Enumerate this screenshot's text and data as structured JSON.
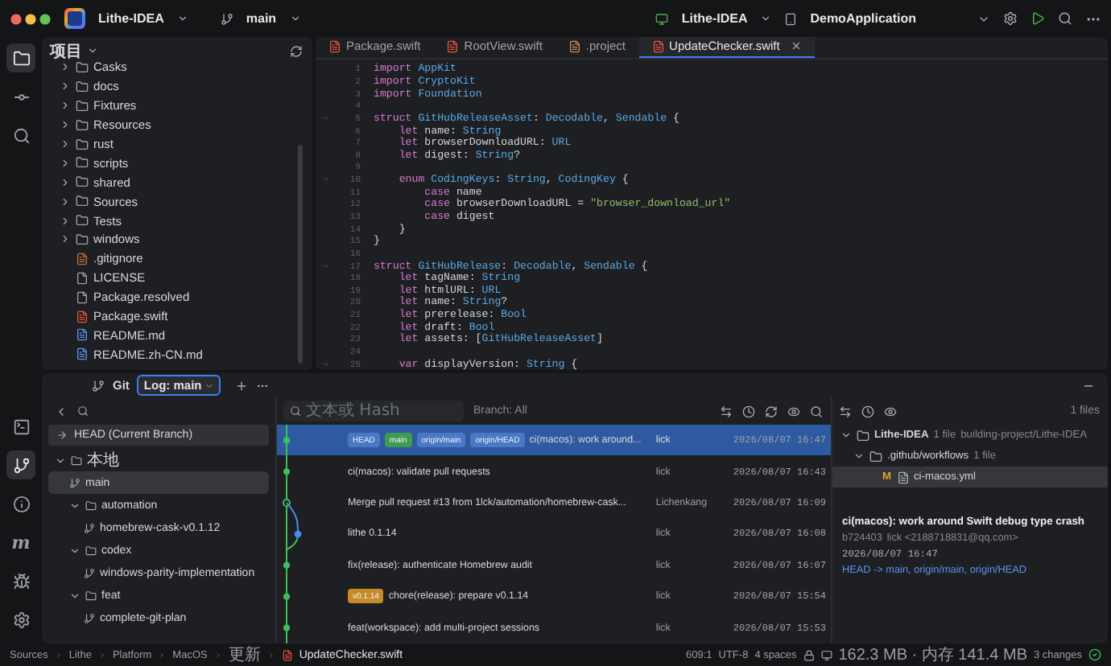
{
  "title_bar": {
    "project": "Lithe-IDEA",
    "branch": "main",
    "run_config": "Lithe-IDEA",
    "device": "DemoApplication"
  },
  "activity_bar": {
    "top": [
      {
        "kind": "project",
        "selected": true
      },
      {
        "kind": "commit",
        "selected": false
      },
      {
        "kind": "search",
        "selected": false
      }
    ],
    "bottom": [
      {
        "kind": "terminal",
        "selected": false
      },
      {
        "kind": "git",
        "selected": true
      },
      {
        "kind": "problems",
        "selected": false
      },
      {
        "kind": "text",
        "label": "m",
        "selected": false
      },
      {
        "kind": "debug",
        "selected": false
      },
      {
        "kind": "settings",
        "selected": false
      }
    ]
  },
  "project_panel": {
    "title": "项目",
    "items": [
      {
        "kind": "folder",
        "name": "Casks",
        "expanded": false
      },
      {
        "kind": "folder",
        "name": "docs",
        "expanded": false
      },
      {
        "kind": "folder",
        "name": "Fixtures",
        "expanded": false
      },
      {
        "kind": "folder",
        "name": "Resources",
        "expanded": false
      },
      {
        "kind": "folder",
        "name": "rust",
        "expanded": false
      },
      {
        "kind": "folder",
        "name": "scripts",
        "expanded": false
      },
      {
        "kind": "folder",
        "name": "shared",
        "expanded": false
      },
      {
        "kind": "folder",
        "name": "Sources",
        "expanded": false
      },
      {
        "kind": "folder",
        "name": "Tests",
        "expanded": false
      },
      {
        "kind": "folder",
        "name": "windows",
        "expanded": false
      },
      {
        "kind": "ignore",
        "name": ".gitignore"
      },
      {
        "kind": "doc",
        "name": "LICENSE"
      },
      {
        "kind": "doc",
        "name": "Package.resolved"
      },
      {
        "kind": "swift",
        "name": "Package.swift"
      },
      {
        "kind": "markdown",
        "name": "README.md"
      },
      {
        "kind": "markdown",
        "name": "README.zh-CN.md"
      }
    ]
  },
  "editor": {
    "tabs": [
      {
        "kind": "swift",
        "label": "Package.swift",
        "selected": false
      },
      {
        "kind": "swift",
        "label": "RootView.swift",
        "selected": false
      },
      {
        "kind": "xml",
        "label": ".project",
        "selected": false
      },
      {
        "kind": "swift",
        "label": "UpdateChecker.swift",
        "selected": true
      }
    ],
    "lines": [
      {
        "number": "1",
        "tokens": [
          {
            "kind": "kw",
            "text": "import "
          },
          {
            "kind": "type",
            "text": "AppKit"
          }
        ]
      },
      {
        "number": "2",
        "tokens": [
          {
            "kind": "kw",
            "text": "import "
          },
          {
            "kind": "type",
            "text": "CryptoKit"
          }
        ]
      },
      {
        "number": "3",
        "tokens": [
          {
            "kind": "kw",
            "text": "import "
          },
          {
            "kind": "type",
            "text": "Foundation"
          }
        ]
      },
      {
        "number": "4"
      },
      {
        "number": "5",
        "fold": true,
        "tokens": [
          {
            "kind": "kw",
            "text": "struct "
          },
          {
            "kind": "type",
            "text": "GitHubReleaseAsset"
          },
          {
            "kind": "plain",
            "text": ": "
          },
          {
            "kind": "type",
            "text": "Decodable"
          },
          {
            "kind": "plain",
            "text": ", "
          },
          {
            "kind": "type",
            "text": "Sendable"
          },
          {
            "kind": "plain",
            "text": " {"
          }
        ]
      },
      {
        "number": "6",
        "tokens": [
          {
            "kind": "kw",
            "text": "    let "
          },
          {
            "kind": "plain",
            "text": "name: "
          },
          {
            "kind": "type",
            "text": "String"
          }
        ]
      },
      {
        "number": "7",
        "tokens": [
          {
            "kind": "kw",
            "text": "    let "
          },
          {
            "kind": "plain",
            "text": "browserDownloadURL: "
          },
          {
            "kind": "type",
            "text": "URL"
          }
        ]
      },
      {
        "number": "8",
        "tokens": [
          {
            "kind": "kw",
            "text": "    let "
          },
          {
            "kind": "plain",
            "text": "digest: "
          },
          {
            "kind": "type",
            "text": "String"
          },
          {
            "kind": "plain",
            "text": "?"
          }
        ]
      },
      {
        "number": "9"
      },
      {
        "number": "10",
        "fold": true,
        "tokens": [
          {
            "kind": "kw",
            "text": "    enum "
          },
          {
            "kind": "type",
            "text": "CodingKeys"
          },
          {
            "kind": "plain",
            "text": ": "
          },
          {
            "kind": "type",
            "text": "String"
          },
          {
            "kind": "plain",
            "text": ", "
          },
          {
            "kind": "type",
            "text": "CodingKey"
          },
          {
            "kind": "plain",
            "text": " {"
          }
        ]
      },
      {
        "number": "11",
        "tokens": [
          {
            "kind": "kw",
            "text": "        case "
          },
          {
            "kind": "plain",
            "text": "name"
          }
        ]
      },
      {
        "number": "12",
        "tokens": [
          {
            "kind": "kw",
            "text": "        case "
          },
          {
            "kind": "plain",
            "text": "browserDownloadURL = "
          },
          {
            "kind": "str",
            "text": "\"browser_download_url\""
          }
        ]
      },
      {
        "number": "13",
        "tokens": [
          {
            "kind": "kw",
            "text": "        case "
          },
          {
            "kind": "plain",
            "text": "digest"
          }
        ]
      },
      {
        "number": "14",
        "tokens": [
          {
            "kind": "plain",
            "text": "    }"
          }
        ]
      },
      {
        "number": "15",
        "tokens": [
          {
            "kind": "plain",
            "text": "}"
          }
        ]
      },
      {
        "number": "16"
      },
      {
        "number": "17",
        "fold": true,
        "tokens": [
          {
            "kind": "kw",
            "text": "struct "
          },
          {
            "kind": "type",
            "text": "GitHubRelease"
          },
          {
            "kind": "plain",
            "text": ": "
          },
          {
            "kind": "type",
            "text": "Decodable"
          },
          {
            "kind": "plain",
            "text": ", "
          },
          {
            "kind": "type",
            "text": "Sendable"
          },
          {
            "kind": "plain",
            "text": " {"
          }
        ]
      },
      {
        "number": "18",
        "tokens": [
          {
            "kind": "kw",
            "text": "    let "
          },
          {
            "kind": "plain",
            "text": "tagName: "
          },
          {
            "kind": "type",
            "text": "String"
          }
        ]
      },
      {
        "number": "19",
        "tokens": [
          {
            "kind": "kw",
            "text": "    let "
          },
          {
            "kind": "plain",
            "text": "htmlURL: "
          },
          {
            "kind": "type",
            "text": "URL"
          }
        ]
      },
      {
        "number": "20",
        "tokens": [
          {
            "kind": "kw",
            "text": "    let "
          },
          {
            "kind": "plain",
            "text": "name: "
          },
          {
            "kind": "type",
            "text": "String"
          },
          {
            "kind": "plain",
            "text": "?"
          }
        ]
      },
      {
        "number": "21",
        "tokens": [
          {
            "kind": "kw",
            "text": "    let "
          },
          {
            "kind": "plain",
            "text": "prerelease: "
          },
          {
            "kind": "type",
            "text": "Bool"
          }
        ]
      },
      {
        "number": "22",
        "tokens": [
          {
            "kind": "kw",
            "text": "    let "
          },
          {
            "kind": "plain",
            "text": "draft: "
          },
          {
            "kind": "type",
            "text": "Bool"
          }
        ]
      },
      {
        "number": "23",
        "tokens": [
          {
            "kind": "kw",
            "text": "    let "
          },
          {
            "kind": "plain",
            "text": "assets: ["
          },
          {
            "kind": "type",
            "text": "GitHubReleaseAsset"
          },
          {
            "kind": "plain",
            "text": "]"
          }
        ]
      },
      {
        "number": "24"
      },
      {
        "number": "25",
        "fold": true,
        "tokens": [
          {
            "kind": "kw",
            "text": "    var "
          },
          {
            "kind": "plain",
            "text": "displayVersion: "
          },
          {
            "kind": "type",
            "text": "String"
          },
          {
            "kind": "plain",
            "text": " {"
          }
        ]
      }
    ]
  },
  "git_panel": {
    "title": "Git",
    "log_tab": "Log: main",
    "branches": {
      "head": "HEAD (Current Branch)",
      "tree": [
        {
          "kind": "folder",
          "name": "本地",
          "expanded": true,
          "children": [
            {
              "kind": "branch",
              "name": "main",
              "selected": true
            },
            {
              "kind": "folder",
              "name": "automation",
              "expanded": true,
              "children": [
                {
                  "kind": "branch",
                  "name": "homebrew-cask-v0.1.12",
                  "selected": false
                }
              ]
            },
            {
              "kind": "folder",
              "name": "codex",
              "expanded": true,
              "children": [
                {
                  "kind": "branch",
                  "name": "windows-parity-implementation",
                  "selected": false
                }
              ]
            },
            {
              "kind": "folder",
              "name": "feat",
              "expanded": true,
              "children": [
                {
                  "kind": "branch",
                  "name": "complete-git-plan",
                  "selected": false
                }
              ]
            }
          ]
        }
      ]
    },
    "log": {
      "search": {
        "placeholder": "文本或 Hash"
      },
      "branch_filter": "Branch: All",
      "commits": [
        {
          "kind": "commit",
          "selected": true,
          "refs": [
            {
              "label": "HEAD",
              "color": "#4a78c4"
            },
            {
              "label": "main",
              "color": "#3f9a52"
            },
            {
              "label": "origin/main",
              "color": "#4a78c4"
            },
            {
              "label": "origin/HEAD",
              "color": "#4a78c4"
            }
          ],
          "message": "ci(macos): work around...",
          "author": "lick",
          "date": "2026/08/07 16:47"
        },
        {
          "kind": "commit",
          "selected": false,
          "message": "ci(macos): validate pull requests",
          "author": "lick",
          "date": "2026/08/07 16:43"
        },
        {
          "kind": "merge",
          "selected": false,
          "message": "Merge pull request #13 from 1lck/automation/homebrew-cask...",
          "author": "Lichenkang",
          "date": "2026/08/07 16:09"
        },
        {
          "kind": "side",
          "selected": false,
          "message": "lithe 0.1.14",
          "author": "lick",
          "date": "2026/08/07 16:08"
        },
        {
          "kind": "commit",
          "selected": false,
          "message": "fix(release): authenticate Homebrew audit",
          "author": "lick",
          "date": "2026/08/07 16:07"
        },
        {
          "kind": "commit",
          "selected": false,
          "refs": [
            {
              "label": "v0.1.14",
              "color": "#c98a2a"
            }
          ],
          "message": "chore(release): prepare v0.1.14",
          "author": "lick",
          "date": "2026/08/07 15:54"
        },
        {
          "kind": "commit",
          "selected": false,
          "message": "feat(workspace): add multi-project sessions",
          "author": "lick",
          "date": "2026/08/07 15:53"
        }
      ]
    },
    "details": {
      "count": "1 files",
      "tree": [
        {
          "kind": "folder",
          "name": "Lithe-IDEA",
          "note": "1 file",
          "path": "building-project/Lithe-IDEA",
          "expanded": true,
          "children": [
            {
              "kind": "folder",
              "name": ".github/workflows",
              "note": "1 file",
              "expanded": true,
              "children": [
                {
                  "kind": "file",
                  "status": "M",
                  "name": "ci-macos.yml",
                  "selected": true
                }
              ]
            }
          ]
        }
      ],
      "commit": {
        "title": "ci(macos): work around Swift debug type crash",
        "hash": "b724403",
        "author": "lick <2188718831@qq.com>",
        "date": "2026/08/07 16:47",
        "refs": "HEAD -> main, origin/main, origin/HEAD"
      }
    }
  },
  "status_bar": {
    "breadcrumb": [
      "Sources",
      "Lithe",
      "Platform",
      "MacOS",
      "更新",
      "UpdateChecker.swift"
    ],
    "position": "609:1",
    "encoding": "UTF-8",
    "indent": "4 spaces",
    "memory": "162.3 MB · 内存 141.4 MB",
    "changes": "3 changes"
  }
}
